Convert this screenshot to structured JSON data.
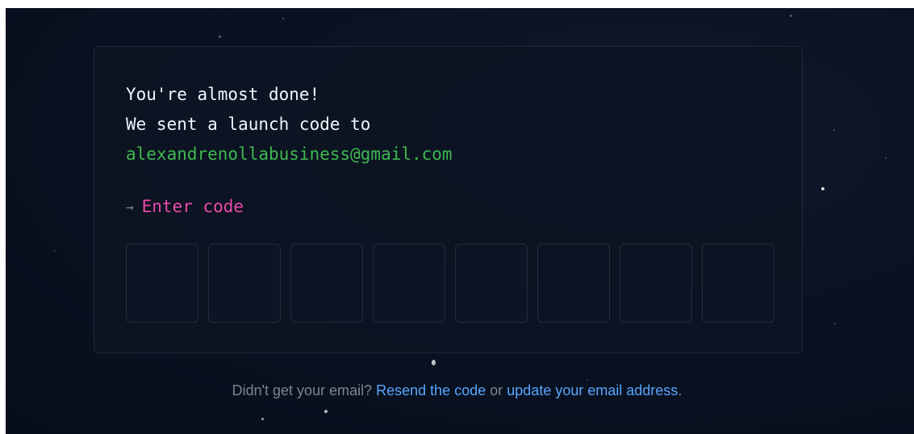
{
  "card": {
    "line1": "You're almost done!",
    "line2": "We sent a launch code to",
    "email": "alexandrenollabusiness@gmail.com",
    "arrow_glyph": "→",
    "enter_code_label": "Enter code",
    "code_length": 8
  },
  "footer": {
    "prefix": "Didn't get your email?",
    "resend_link": "Resend the code",
    "middle": "or",
    "update_link": "update your email address",
    "suffix": "."
  },
  "colors": {
    "background": "#0a1222",
    "text_primary": "#f0f6fc",
    "email": "#3fb950",
    "enter_code": "#ea4aaa",
    "link": "#58a6ff",
    "muted": "#7d8590"
  }
}
